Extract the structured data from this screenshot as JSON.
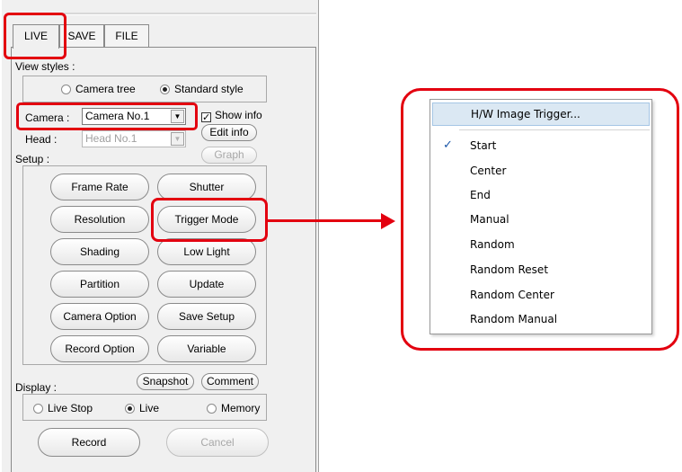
{
  "tabs": [
    {
      "label": "LIVE",
      "active": true
    },
    {
      "label": "SAVE",
      "active": false
    },
    {
      "label": "FILE",
      "active": false
    }
  ],
  "view_styles": {
    "label": "View styles :",
    "options": [
      {
        "label": "Camera tree",
        "selected": false
      },
      {
        "label": "Standard style",
        "selected": true
      }
    ]
  },
  "camera": {
    "label": "Camera :",
    "value": "Camera No.1"
  },
  "show_info": {
    "label": "Show info",
    "checked": true
  },
  "head": {
    "label": "Head :",
    "value": "Head No.1",
    "disabled": true
  },
  "edit_info_label": "Edit info",
  "graph_label": "Graph",
  "setup": {
    "label": "Setup :",
    "buttons": [
      "Frame Rate",
      "Shutter",
      "Resolution",
      "Trigger Mode",
      "Shading",
      "Low Light",
      "Partition",
      "Update",
      "Camera Option",
      "Save Setup",
      "Record Option",
      "Variable"
    ]
  },
  "display": {
    "label": "Display :",
    "snapshot_label": "Snapshot",
    "comment_label": "Comment",
    "options": [
      {
        "label": "Live Stop",
        "selected": false
      },
      {
        "label": "Live",
        "selected": true
      },
      {
        "label": "Memory",
        "selected": false
      }
    ]
  },
  "record_label": "Record",
  "cancel_label": "Cancel",
  "trigger_menu": {
    "items": [
      {
        "label": "H/W Image Trigger...",
        "checked": false,
        "highlighted": true
      },
      {
        "label": "Start",
        "checked": true
      },
      {
        "label": "Center",
        "checked": false
      },
      {
        "label": "End",
        "checked": false
      },
      {
        "label": "Manual",
        "checked": false
      },
      {
        "label": "Random",
        "checked": false
      },
      {
        "label": "Random Reset",
        "checked": false
      },
      {
        "label": "Random Center",
        "checked": false
      },
      {
        "label": "Random Manual",
        "checked": false
      }
    ],
    "check_glyph": "✓"
  },
  "colors": {
    "highlight_red": "#e3000f",
    "menu_hover": "#dbe8f3",
    "check_blue": "#1a56a8"
  }
}
